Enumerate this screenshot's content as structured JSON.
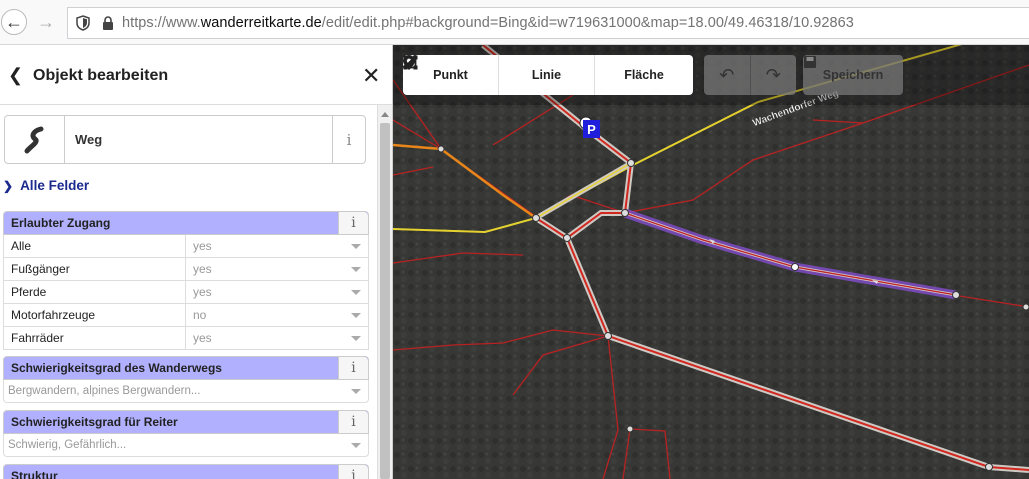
{
  "browser": {
    "url_prefix": "https://www.",
    "url_domain": "wanderreitkarte.de",
    "url_rest": "/edit/edit.php#background=Bing&id=w719631000&map=18.00/49.46318/10.92863"
  },
  "sidebar": {
    "title": "Objekt bearbeiten",
    "preset_name": "Weg",
    "info_glyph": "i",
    "all_fields_label": "Alle Felder",
    "fields": [
      {
        "label": "Erlaubter Zugang",
        "rows": [
          {
            "key": "Alle",
            "value": "yes"
          },
          {
            "key": "Fußgänger",
            "value": "yes"
          },
          {
            "key": "Pferde",
            "value": "yes"
          },
          {
            "key": "Motorfahrzeuge",
            "value": "no"
          },
          {
            "key": "Fahrräder",
            "value": "yes"
          }
        ]
      },
      {
        "label": "Schwierigkeitsgrad des Wanderwegs",
        "placeholder": "Bergwandern, alpines Bergwandern..."
      },
      {
        "label": "Schwierigkeitsgrad für Reiter",
        "placeholder": "Schwierig, Gefährlich..."
      },
      {
        "label": "Struktur"
      }
    ]
  },
  "map": {
    "toolbar": {
      "point": "Punkt",
      "line": "Linie",
      "area": "Fläche",
      "save": "Speichern"
    },
    "street_label": "Wachendorfer Weg",
    "parking_label": "P"
  },
  "colors": {
    "field_header": "#b0b0ff",
    "accent_blue": "#1a2a8e",
    "selection": "#8a4fd8"
  }
}
